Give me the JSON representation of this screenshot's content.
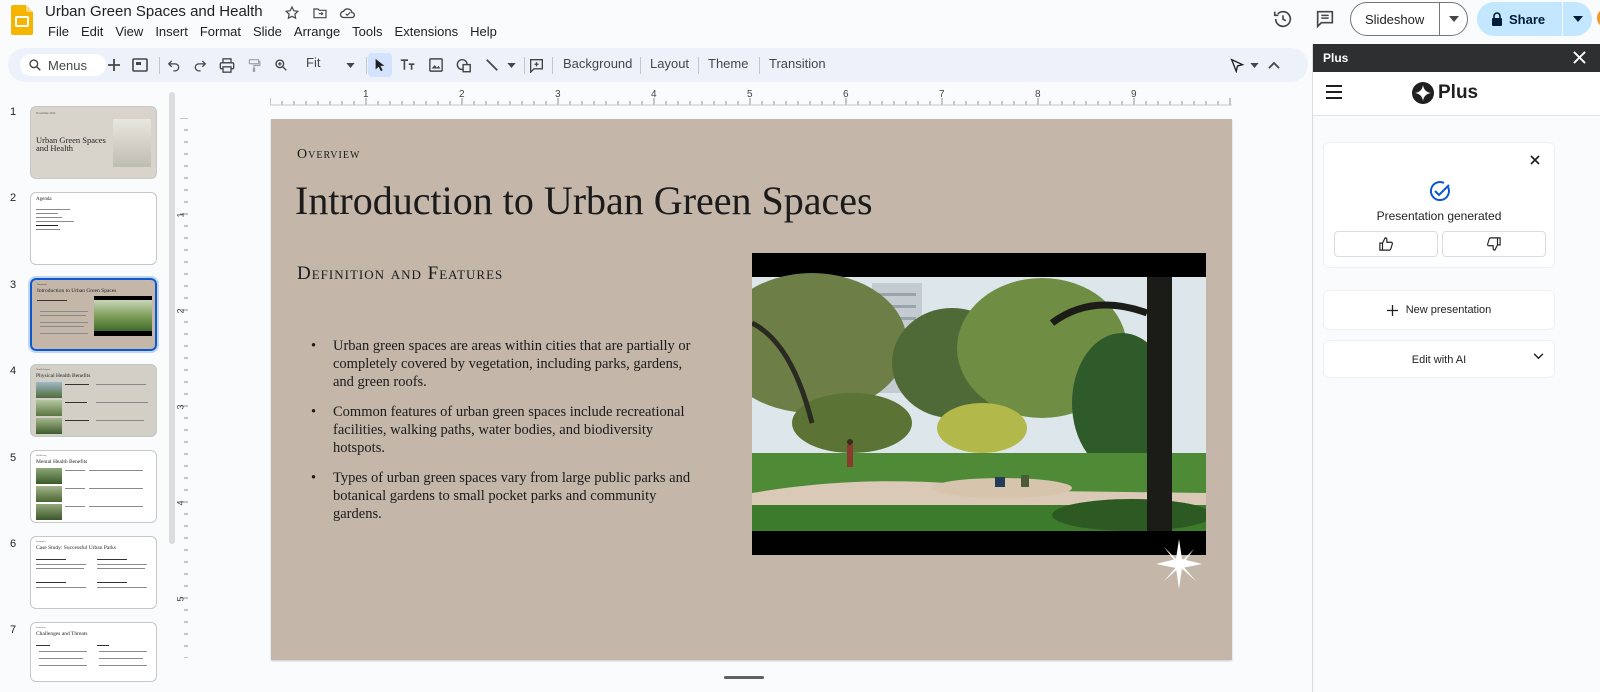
{
  "app": {
    "doc_title": "Urban Green Spaces and Health",
    "menu": [
      "File",
      "Edit",
      "View",
      "Insert",
      "Format",
      "Slide",
      "Arrange",
      "Tools",
      "Extensions",
      "Help"
    ],
    "slideshow_label": "Slideshow",
    "share_label": "Share"
  },
  "toolbar": {
    "search_label": "Menus",
    "zoom_value": "Fit",
    "background_label": "Background",
    "layout_label": "Layout",
    "theme_label": "Theme",
    "transition_label": "Transition"
  },
  "ruler": {
    "h_marks": [
      "1",
      "2",
      "3",
      "4",
      "5",
      "6",
      "7",
      "8",
      "9"
    ],
    "v_marks": [
      "1",
      "2",
      "3",
      "4",
      "5"
    ]
  },
  "filmstrip": {
    "slides": [
      {
        "number": "1",
        "title": "Urban Green Spaces and Health"
      },
      {
        "number": "2",
        "title": "Agenda"
      },
      {
        "number": "3",
        "title": "Introduction to Urban Green Spaces"
      },
      {
        "number": "4",
        "title": "Physical Health Benefits"
      },
      {
        "number": "5",
        "title": "Mental Health Benefits"
      },
      {
        "number": "6",
        "title": "Case Study: Successful Urban Parks"
      },
      {
        "number": "7",
        "title": "Challenges and Threats"
      }
    ],
    "selected": "3"
  },
  "slide": {
    "overline": "Overview",
    "title": "Introduction to Urban Green Spaces",
    "subtitle": "Definition and Features",
    "bullets": [
      "Urban green spaces are areas within cities that are partially or completely covered by vegetation, including parks, gardens, and green roofs.",
      "Common features of urban green spaces include recreational facilities, walking paths, water bodies, and biodiversity hotspots.",
      "Types of urban green spaces vary from large public parks and botanical gardens to small pocket parks and community gardens."
    ],
    "background_color": "#c4b6a9"
  },
  "panel": {
    "header": "Plus",
    "brand": "Plus",
    "status_text": "Presentation generated",
    "new_presentation_label": "New presentation",
    "edit_ai_label": "Edit with AI"
  },
  "colors": {
    "accent": "#0b57d0",
    "share_bg": "#c2e7ff",
    "toolbar_bg": "#edf2fa"
  }
}
